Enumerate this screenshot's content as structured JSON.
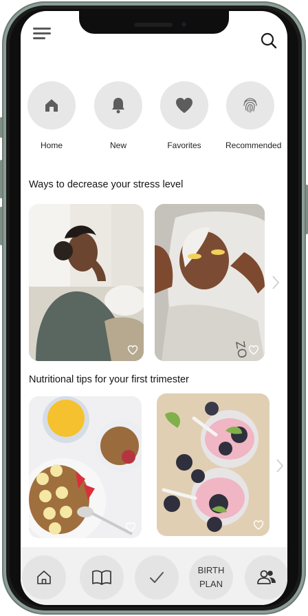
{
  "categories": [
    {
      "label": "Home",
      "icon": "home-icon"
    },
    {
      "label": "New",
      "icon": "bell-icon"
    },
    {
      "label": "Favorites",
      "icon": "heart-icon"
    },
    {
      "label": "Recommended",
      "icon": "fingerprint-icon"
    }
  ],
  "sections": [
    {
      "title": "Ways to decrease your stress level"
    },
    {
      "title": "Nutritional tips for your first trimester"
    }
  ],
  "bottom_nav": {
    "birth_plan_line1": "BIRTH",
    "birth_plan_line2": "PLAN",
    "icons": [
      "home-icon",
      "book-icon",
      "checkmark-icon",
      "birth-plan",
      "people-icon"
    ]
  },
  "colors": {
    "frame": "#8c9e96",
    "circle_bg": "#e7e7e7",
    "bottom_bar_bg": "#f1f1f1"
  }
}
